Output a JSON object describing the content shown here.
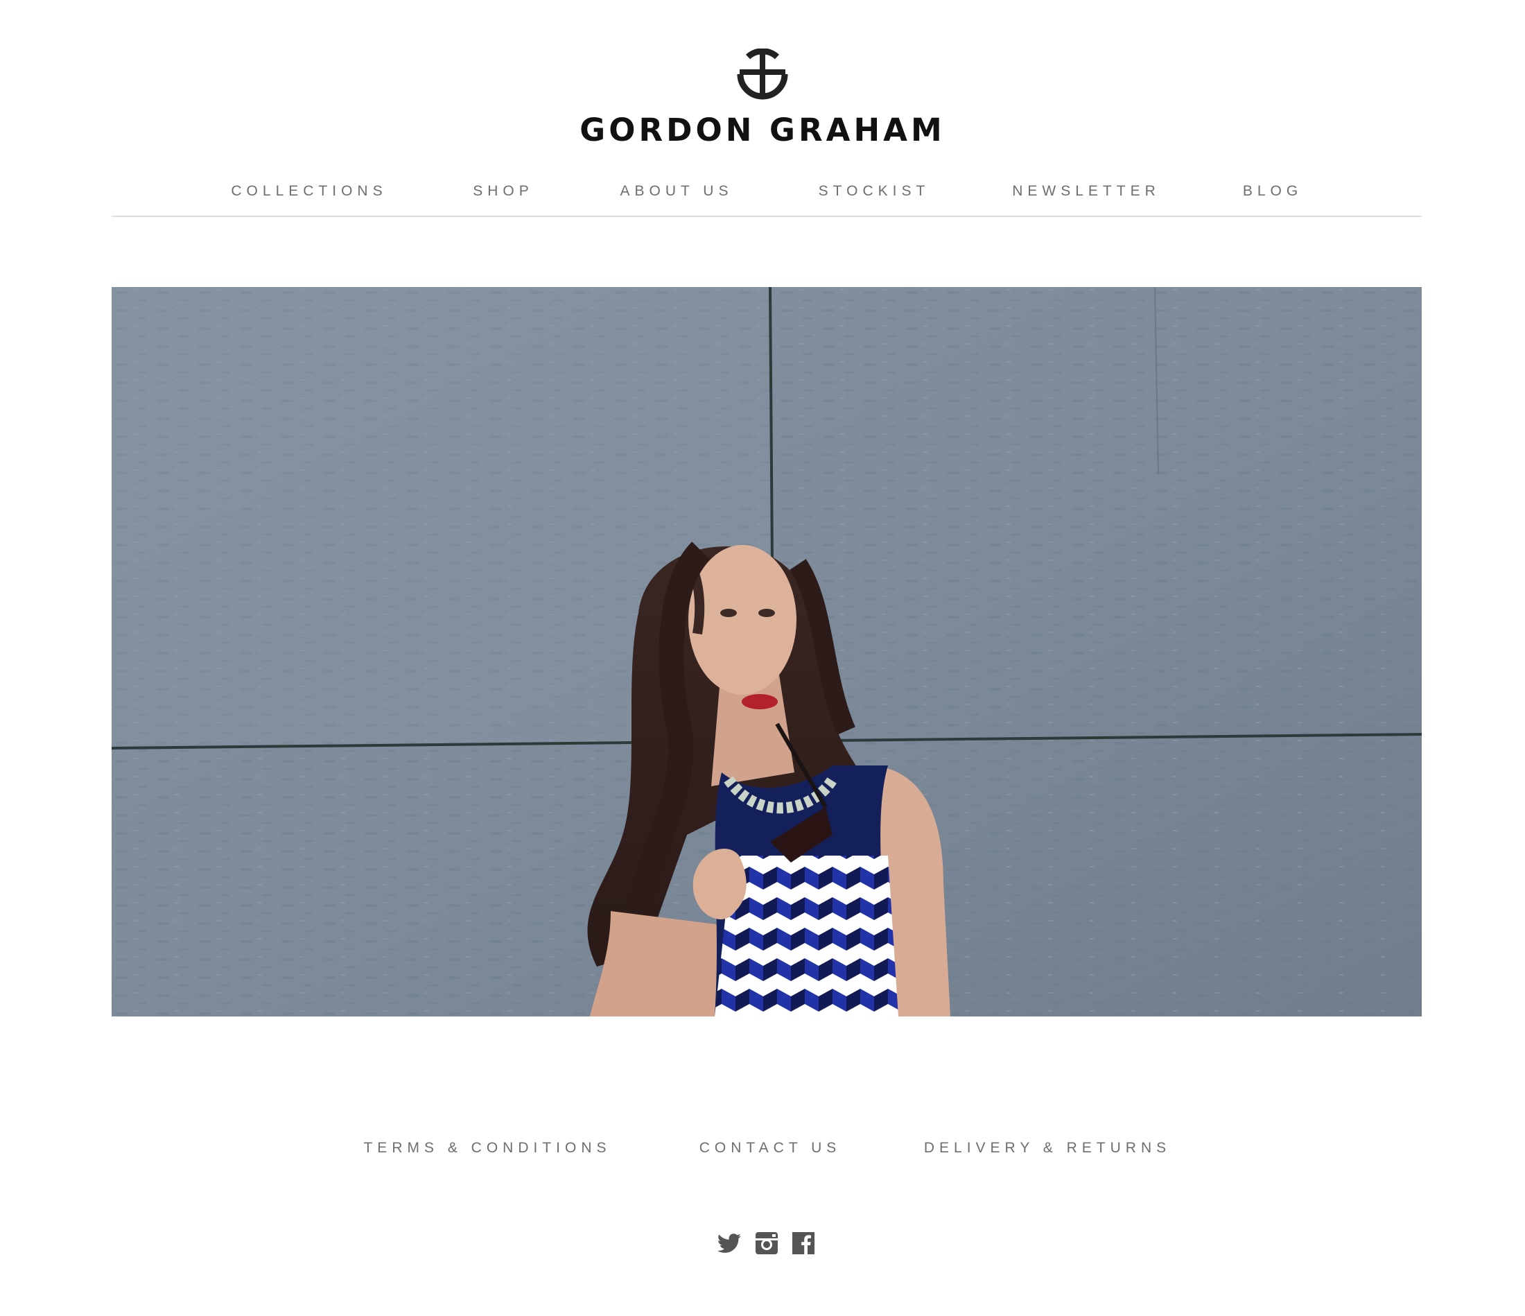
{
  "brand": {
    "name": "GORDON GRAHAM",
    "logo_icon": "gordon-graham-monogram",
    "text_color": "#111111"
  },
  "nav": {
    "items": [
      {
        "label": "COLLECTIONS"
      },
      {
        "label": "SHOP"
      },
      {
        "label": "ABOUT US"
      },
      {
        "label": "STOCKIST"
      },
      {
        "label": "NEWSLETTER"
      },
      {
        "label": "BLOG"
      }
    ],
    "text_color": "#6e6e6e"
  },
  "hero": {
    "subject": "fashion-model-photo"
  },
  "footer": {
    "links": [
      {
        "label": "TERMS & CONDITIONS"
      },
      {
        "label": "CONTACT US"
      },
      {
        "label": "DELIVERY & RETURNS"
      }
    ],
    "social": [
      {
        "icon": "twitter-icon"
      },
      {
        "icon": "instagram-icon"
      },
      {
        "icon": "facebook-icon"
      }
    ],
    "icon_color": "#555555"
  }
}
